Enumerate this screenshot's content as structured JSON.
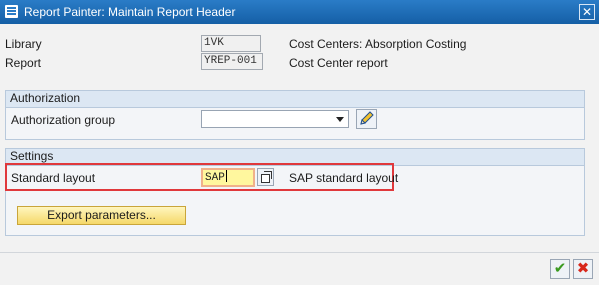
{
  "window": {
    "title": "Report Painter: Maintain Report Header",
    "close_symbol": "✕"
  },
  "header_fields": {
    "library_label": "Library",
    "library_value": "1VK",
    "library_desc": "Cost Centers: Absorption Costing",
    "report_label": "Report",
    "report_value": "YREP-001",
    "report_desc": "Cost Center report"
  },
  "authorization": {
    "section_title": "Authorization",
    "group_label": "Authorization group",
    "group_value": ""
  },
  "settings": {
    "section_title": "Settings",
    "layout_label": "Standard layout",
    "layout_value": "SAP",
    "layout_desc": "SAP standard layout",
    "export_button": "Export parameters..."
  },
  "footer": {
    "ok_symbol": "✔",
    "cancel_symbol": "✖"
  },
  "colors": {
    "titlebar": "#1c6cb5",
    "highlight": "#e0383b",
    "input_yellow": "#fff79e"
  }
}
